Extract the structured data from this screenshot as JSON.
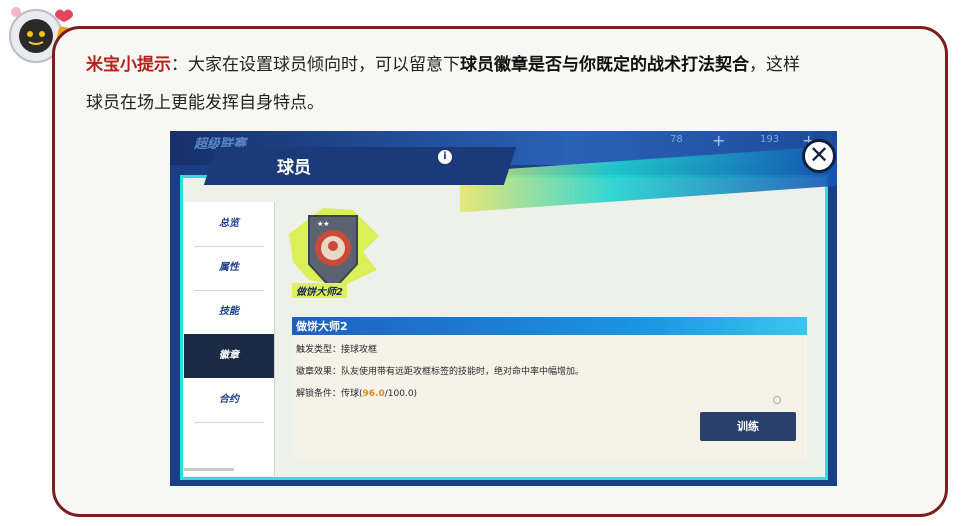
{
  "tip": {
    "label": "米宝小提示",
    "colon": "：",
    "text_before": "大家在设置球员倾向时，可以留意下",
    "bold_text": "球员徽章是否与你既定的战术打法契合",
    "text_after": "，这样",
    "line2": "球员在场上更能发挥自身特点。"
  },
  "game": {
    "top_title": "超级联赛",
    "res1": "78",
    "res2": "193",
    "close_symbol": "✕",
    "header_title": "球员",
    "info_symbol": "i",
    "sidebar": [
      {
        "label": "总览"
      },
      {
        "label": "属性"
      },
      {
        "label": "技能"
      },
      {
        "label": "徽章",
        "active": true
      },
      {
        "label": "合约"
      }
    ],
    "badge_name": "做饼大师2",
    "detail": {
      "title": "做饼大师2",
      "trigger_label": "触发类型：",
      "trigger_value": "接球攻框",
      "effect_label": "徽章效果：",
      "effect_value": "队友使用带有远距攻框标签的技能时，绝对命中率中幅增加。",
      "unlock_label": "解锁条件：",
      "unlock_prefix": "传球(",
      "unlock_current": "96.0",
      "unlock_suffix": "/100.0)"
    },
    "train_button": "训练"
  },
  "colors": {
    "border": "#7a1f1f",
    "tip_label": "#b4231b",
    "accent_cyan": "#2ae0dc",
    "navy": "#1c2b45",
    "unlock_highlight": "#e48a22"
  }
}
